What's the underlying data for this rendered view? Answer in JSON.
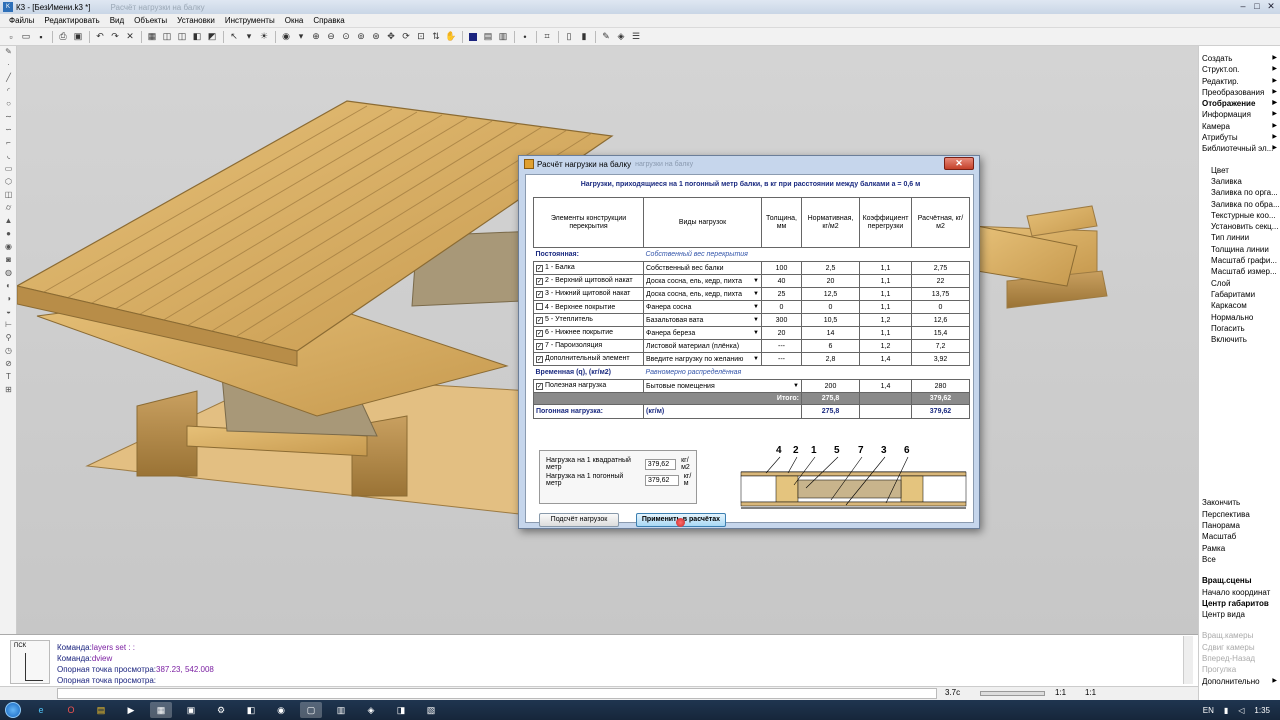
{
  "window": {
    "title": "К3 - [БезИмени.k3 *]",
    "ghost_title": "Расчёт нагрузки на балку"
  },
  "menu": [
    "Файлы",
    "Редактировать",
    "Вид",
    "Объекты",
    "Установки",
    "Инструменты",
    "Окна",
    "Справка"
  ],
  "right_panel": {
    "group1": [
      {
        "label": "Создать",
        "arrow": true,
        "bold": false
      },
      {
        "label": "Структ.оп.",
        "arrow": true,
        "bold": false
      },
      {
        "label": "Редактир.",
        "arrow": true,
        "bold": false
      },
      {
        "label": "Преобразования",
        "arrow": true,
        "bold": false
      },
      {
        "label": "Отображение",
        "arrow": true,
        "bold": true
      },
      {
        "label": "Информация",
        "arrow": true,
        "bold": false
      },
      {
        "label": "Камера",
        "arrow": true,
        "bold": false
      },
      {
        "label": "Атрибуты",
        "arrow": true,
        "bold": false
      },
      {
        "label": "Библиотечный эл...",
        "arrow": true,
        "bold": false
      }
    ],
    "group2": [
      "Цвет",
      "Заливка",
      "Заливка по орга...",
      "Заливка по обра...",
      "Текстурные коо...",
      "Установить секц...",
      "Тип линии",
      "Толщина линии",
      "Масштаб графи...",
      "Масштаб измер...",
      "Слой",
      "Габаритами",
      "Каркасом",
      "Нормально",
      "Погасить",
      "Включить"
    ],
    "group3": [
      "Закончить",
      "Перспектива",
      "Панорама",
      "Масштаб",
      "Рамка",
      "Все"
    ],
    "group4": [
      {
        "label": "Вращ.сцены",
        "bold": true,
        "dim": false
      },
      {
        "label": "Начало координат",
        "bold": false,
        "dim": false
      },
      {
        "label": "Центр габаритов",
        "bold": true,
        "dim": false
      },
      {
        "label": "Центр вида",
        "bold": false,
        "dim": false
      }
    ],
    "group5": [
      {
        "label": "Вращ.камеры",
        "dim": true
      },
      {
        "label": "Сдвиг камеры",
        "dim": true
      },
      {
        "label": "Вперед-Назад",
        "dim": true
      },
      {
        "label": "Прогулка",
        "dim": true
      },
      {
        "label": "Дополнительно",
        "dim": false
      }
    ]
  },
  "command": {
    "ucs_label": "ПСК",
    "lines": [
      {
        "label": "Команда:",
        "value": "layers set : :"
      },
      {
        "label": "Команда:",
        "value": "dview"
      },
      {
        "label": "Опорная точка просмотра:",
        "value": "387.23, 542.008"
      },
      {
        "label": "Опорная точка просмотра:",
        "value": ""
      }
    ]
  },
  "status": {
    "scale": "3.7с",
    "r1": "1:1",
    "r2": "1:1"
  },
  "tray": {
    "lang": "EN",
    "time": "1:35"
  },
  "dialog": {
    "title": "Расчёт нагрузки на балку",
    "ghost": "нагрузки на балку",
    "heading": "Нагрузки, приходящиеся на 1 погонный метр балки, в кг при расстоянии между балками  a = 0,6 м",
    "headers": [
      "Элементы конструкции перекрытия",
      "Виды нагрузок",
      "Толщина, мм",
      "Нормативная, кг/м2",
      "Коэффициент перегрузки",
      "Расчётная, кг/м2"
    ],
    "const_title": "Постоянная:",
    "const_sub": "Собственный вес перекрытия",
    "rows": [
      {
        "name": "1 - Балка",
        "type": "Собственный вес балки",
        "dd": false,
        "t": "100",
        "norm": "2,5",
        "k": "1,1",
        "calc": "2,75"
      },
      {
        "name": "2 - Верхний щитовой накат",
        "type": "Доска сосна, ель, кедр, пихта",
        "dd": true,
        "t": "40",
        "norm": "20",
        "k": "1,1",
        "calc": "22"
      },
      {
        "name": "3 - Нижний щитовой накат",
        "type": "Доска сосна, ель, кедр, пихта",
        "dd": true,
        "t": "25",
        "norm": "12,5",
        "k": "1,1",
        "calc": "13,75"
      },
      {
        "name": "4 - Верхнее покрытие",
        "type": "Фанера сосна",
        "dd": true,
        "t": "0",
        "norm": "0",
        "k": "1,1",
        "calc": "0"
      },
      {
        "name": "5 - Утеплитель",
        "type": "Базальтовая вата",
        "dd": true,
        "t": "300",
        "norm": "10,5",
        "k": "1,2",
        "calc": "12,6"
      },
      {
        "name": "6 - Нижнее покрытие",
        "type": "Фанера береза",
        "dd": true,
        "t": "20",
        "norm": "14",
        "k": "1,1",
        "calc": "15,4"
      },
      {
        "name": "7 - Пароизоляция",
        "type": "Листовой материал (плёнка)",
        "dd": false,
        "t": "---",
        "norm": "6",
        "k": "1,2",
        "calc": "7,2"
      },
      {
        "name": "Дополнительный элемент",
        "type": "Введите нагрузку по желанию",
        "dd": true,
        "t": "---",
        "norm": "2,8",
        "k": "1,4",
        "calc": "3,92"
      }
    ],
    "temp_title": "Временная (q), (кг/м2)",
    "temp_sub": "Равномерно распределённая",
    "temp_row": {
      "name": "Полезная нагрузка",
      "type": "Бытовые помещения",
      "norm": "200",
      "k": "1,4",
      "calc": "280"
    },
    "itogo": {
      "label": "Итого:",
      "norm": "275,8",
      "calc": "379,62"
    },
    "pogon": {
      "label": "Погонная нагрузка:",
      "unit": "(кг/м)",
      "norm": "275,8",
      "calc": "379,62"
    },
    "result": {
      "sq_label": "Нагрузка на 1 квадратный метр",
      "sq_value": "379,62",
      "sq_unit": "кг/м2",
      "lin_label": "Нагрузка на 1 погонный метр",
      "lin_value": "379,62",
      "lin_unit": "кг/м"
    },
    "buttons": {
      "count": "Подсчёт нагрузок",
      "apply": "Применить в расчётах"
    },
    "diagram_labels": [
      "4",
      "2",
      "1",
      "5",
      "7",
      "3",
      "6"
    ]
  }
}
